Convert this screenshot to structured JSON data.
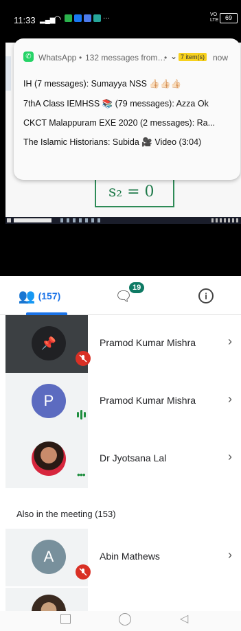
{
  "status": {
    "time": "11:33",
    "volte": "VO LTE",
    "battery": "69"
  },
  "notification": {
    "app": "WhatsApp",
    "subtitle": "132 messages from…",
    "badge": "7 item(s)",
    "when": "now",
    "lines": [
      "IH  (7 messages): Sumayya NSS 👍🏻👍🏻👍🏻",
      "7thA Class IEMHSS 📚 (79 messages): Azza Ok",
      "CKCT Malappuram  EXE 2020 (2 messages): Ra...",
      "The Islamic Historians: Subida 🎥 Video (3:04)"
    ]
  },
  "whiteboard": {
    "formula": "s₂ = 0"
  },
  "tabs": {
    "people_count": "(157)",
    "chat_badge": "19"
  },
  "participants": [
    {
      "name": "Pramod Kumar Mishra",
      "initial": "",
      "avatar": "pin",
      "mic": "muted"
    },
    {
      "name": "Pramod Kumar Mishra",
      "initial": "P",
      "avatar": "#5c6bc0",
      "mic": "speaking"
    },
    {
      "name": "Dr Jyotsana Lal",
      "initial": "",
      "avatar": "photo",
      "mic": "dots"
    }
  ],
  "also_header": "Also in the meeting (153)",
  "others": [
    {
      "name": "Abin Mathews",
      "initial": "A",
      "avatar": "#78909c",
      "mic": "muted"
    }
  ],
  "colors": {
    "accent": "#1a73e8",
    "chat_badge": "#0f7a64",
    "mute": "#d93025",
    "speaking": "#1e8e3e"
  }
}
